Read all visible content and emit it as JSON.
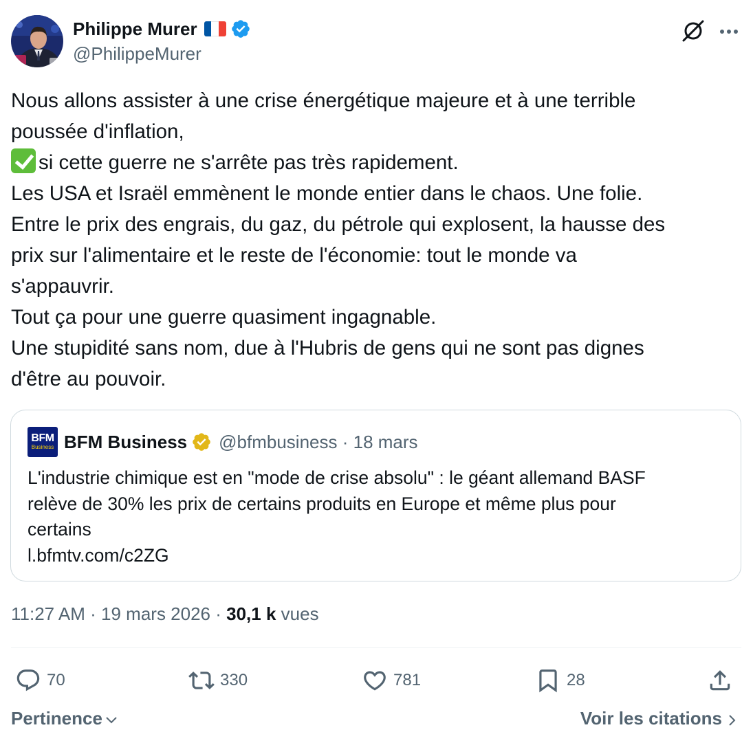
{
  "author": {
    "name": "Philippe Murer",
    "handle": "@PhilippeMurer",
    "flag_colors": [
      "#0055a4",
      "#ffffff",
      "#ef4135"
    ],
    "verified_color": "#1d9bf0"
  },
  "tweet": {
    "lines": [
      "Nous allons assister à une crise énergétique majeure et à une terrible",
      "poussée d'inflation,",
      "si cette guerre ne s'arrête pas très rapidement.",
      "Les USA et Israël emmènent le monde entier dans le chaos. Une folie.",
      "Entre le prix des engrais, du gaz, du pétrole qui explosent, la hausse des",
      "prix sur l'alimentaire et le reste de l'économie: tout le monde va",
      "s'appauvrir.",
      "Tout ça pour une guerre quasiment ingagnable.",
      "Une stupidité sans nom, due à l'Hubris de gens qui ne sont pas dignes",
      "d'être au pouvoir."
    ],
    "emoji_icon": "check-mark-button-icon"
  },
  "quote": {
    "logo_text": "BFM",
    "logo_subtext": "Business",
    "name": "BFM Business",
    "handle_date": "@bfmbusiness · 18 mars",
    "verified_color": "#e2b719",
    "lines": [
      "L'industrie chimique est en \"mode de crise absolu\" : le géant allemand BASF",
      "relève de 30% les prix de certains produits en Europe et même plus pour",
      "certains",
      "l.bfmtv.com/c2ZG"
    ]
  },
  "meta": {
    "time_date": "11:27 AM · 19 mars 2026 · ",
    "views_count": "30,1 k",
    "views_label": " vues"
  },
  "actions": {
    "replies": "70",
    "reposts": "330",
    "likes": "781",
    "bookmarks": "28"
  },
  "footer": {
    "sort_label": "Pertinence",
    "quotes_label": "Voir les citations"
  },
  "colors": {
    "text": "#0f1419",
    "secondary": "#536471",
    "border": "#cfd9de"
  }
}
